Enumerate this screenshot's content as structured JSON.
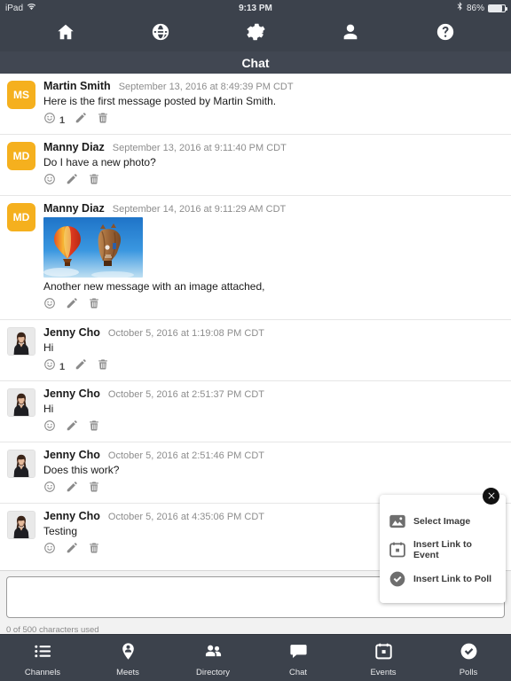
{
  "statusbar": {
    "device": "iPad",
    "wifi_icon": "wifi-icon",
    "time": "9:13 PM",
    "bluetooth_icon": "bluetooth-icon",
    "battery_percent": "86%",
    "battery_level": 86
  },
  "topnav": {
    "items": [
      {
        "name": "home-icon",
        "label": "Home"
      },
      {
        "name": "globe-icon",
        "label": "Globe"
      },
      {
        "name": "gear-icon",
        "label": "Settings"
      },
      {
        "name": "person-icon",
        "label": "Profile"
      },
      {
        "name": "help-icon",
        "label": "Help"
      }
    ]
  },
  "titlebar": {
    "title": "Chat"
  },
  "messages": [
    {
      "author": "Martin Smith",
      "timestamp": "September 13, 2016 at 8:49:39 PM CDT",
      "text": "Here is the first message posted by Martin Smith.",
      "avatar_type": "initials",
      "initials": "MS",
      "avatar_color": "#F5B01E",
      "reaction_count": "1",
      "has_image": false
    },
    {
      "author": "Manny Diaz",
      "timestamp": "September 13, 2016 at 9:11:40 PM CDT",
      "text": "Do I have a new photo?",
      "avatar_type": "initials",
      "initials": "MD",
      "avatar_color": "#F5B01E",
      "reaction_count": "",
      "has_image": false
    },
    {
      "author": "Manny Diaz",
      "timestamp": "September 14, 2016 at 9:11:29 AM CDT",
      "text": "Another new message with an image attached,",
      "avatar_type": "initials",
      "initials": "MD",
      "avatar_color": "#F5B01E",
      "reaction_count": "",
      "has_image": true,
      "image_alt": "hot-air-balloons-photo"
    },
    {
      "author": "Jenny Cho",
      "timestamp": "October 5, 2016 at 1:19:08 PM CDT",
      "text": "Hi",
      "avatar_type": "photo",
      "initials": "",
      "avatar_color": "",
      "reaction_count": "1",
      "has_image": false
    },
    {
      "author": "Jenny Cho",
      "timestamp": "October 5, 2016 at 2:51:37 PM CDT",
      "text": "Hi",
      "avatar_type": "photo",
      "initials": "",
      "avatar_color": "",
      "reaction_count": "",
      "has_image": false
    },
    {
      "author": "Jenny Cho",
      "timestamp": "October 5, 2016 at 2:51:46 PM CDT",
      "text": "Does this work?",
      "avatar_type": "photo",
      "initials": "",
      "avatar_color": "",
      "reaction_count": "",
      "has_image": false
    },
    {
      "author": "Jenny Cho",
      "timestamp": "October 5, 2016 at 4:35:06 PM CDT",
      "text": "Testing",
      "avatar_type": "photo",
      "initials": "",
      "avatar_color": "",
      "reaction_count": "",
      "has_image": false
    }
  ],
  "message_actions": {
    "react_icon": "smiley-icon",
    "edit_icon": "pencil-icon",
    "delete_icon": "trash-icon"
  },
  "composer": {
    "value": "",
    "placeholder": "",
    "char_counter": "0 of 500 characters used"
  },
  "attach_popup": {
    "close_icon": "close-icon",
    "items": [
      {
        "icon": "image-icon",
        "label": "Select Image"
      },
      {
        "icon": "calendar-icon",
        "label": "Insert Link to Event"
      },
      {
        "icon": "check-circle-icon",
        "label": "Insert Link to Poll"
      }
    ]
  },
  "tabbar": {
    "items": [
      {
        "icon": "list-icon",
        "label": "Channels"
      },
      {
        "icon": "map-pin-person-icon",
        "label": "Meets"
      },
      {
        "icon": "people-icon",
        "label": "Directory"
      },
      {
        "icon": "speech-bubble-icon",
        "label": "Chat"
      },
      {
        "icon": "calendar-icon",
        "label": "Events"
      },
      {
        "icon": "check-circle-icon",
        "label": "Polls"
      }
    ]
  },
  "colors": {
    "chrome": "#3c424c",
    "avatar_orange": "#F5B01E",
    "title_bar": "#414752"
  }
}
